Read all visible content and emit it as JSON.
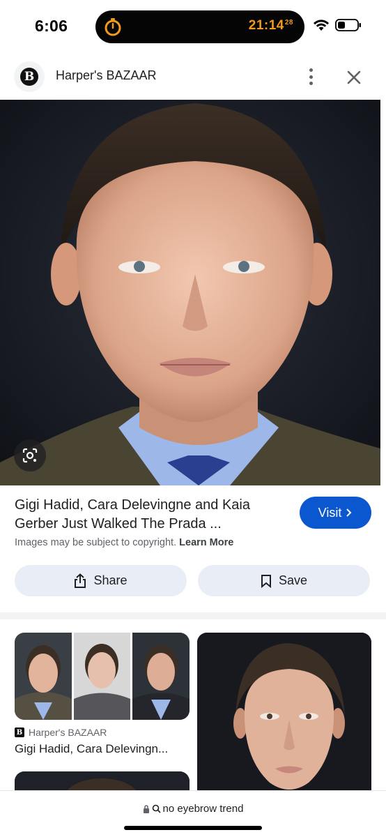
{
  "status_bar": {
    "time": "6:06",
    "timer_main": "21:14",
    "timer_sup": "28",
    "timer_color": "#f19a1d",
    "icons": [
      "timer-icon",
      "wifi-icon",
      "battery-icon"
    ]
  },
  "source": {
    "logo_letter": "B",
    "name": "Harper's BAZAAR",
    "icons": [
      "more-vert-icon",
      "close-icon"
    ]
  },
  "result": {
    "title": "Gigi Hadid, Cara Delevingne and Kaia Gerber Just Walked The Prada ...",
    "visit_label": "Visit",
    "visit_color": "#0b57d0",
    "copyright_text": "Images may be subject to copyright.",
    "learn_more": "Learn More",
    "share_label": "Share",
    "save_label": "Save"
  },
  "related": {
    "card_a_source": "Harper's BAZAAR",
    "card_a_logo": "B",
    "card_a_title": "Gigi Hadid, Cara Delevingn..."
  },
  "search": {
    "query": "no eyebrow trend"
  }
}
